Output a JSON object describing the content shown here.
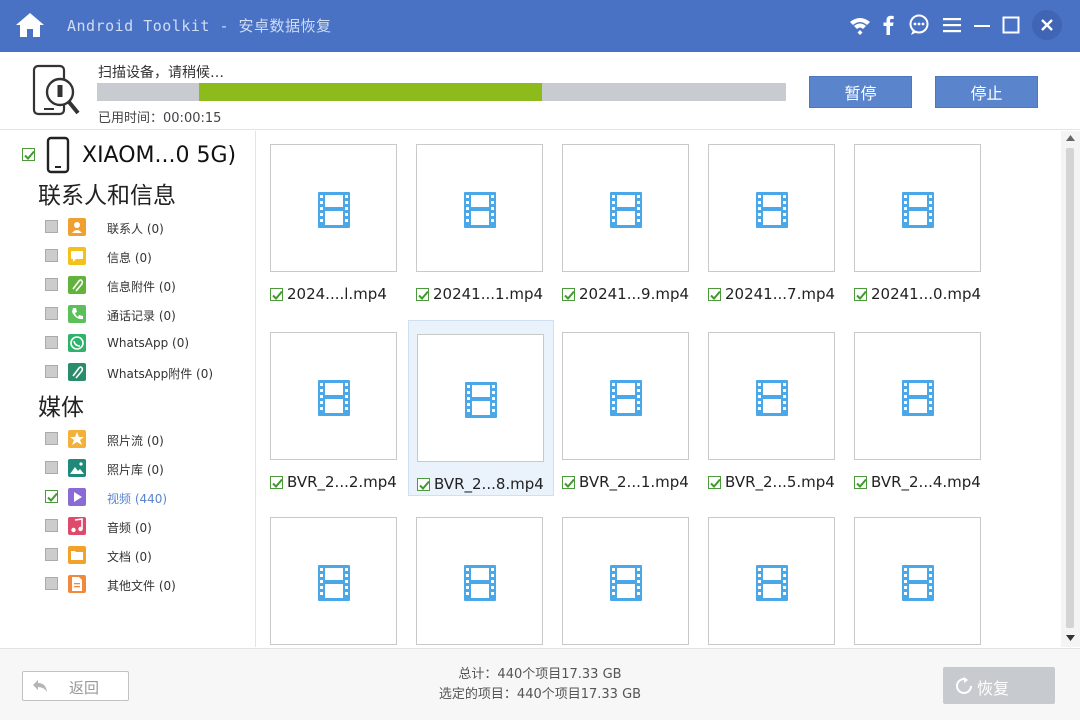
{
  "app": {
    "title": "Android Toolkit - 安卓数据恢复"
  },
  "scan": {
    "status": "扫描设备，请稍候…",
    "elapsed_label": "已用时间：",
    "elapsed_value": "00:00:15",
    "progress": 0.5,
    "pause_label": "暂停",
    "stop_label": "停止"
  },
  "sidebar": {
    "device_name": "XIAOM...0 5G)",
    "groups": [
      {
        "title": "联系人和信息",
        "items": [
          {
            "label": "联系人 (0)",
            "icon": "contacts-icon",
            "color": "#f0a030"
          },
          {
            "label": "信息 (0)",
            "icon": "messages-icon",
            "color": "#f2c21b"
          },
          {
            "label": "信息附件 (0)",
            "icon": "message-attachment-icon",
            "color": "#62b33b"
          },
          {
            "label": "通话记录 (0)",
            "icon": "call-log-icon",
            "color": "#5cc05a"
          },
          {
            "label": "WhatsApp (0)",
            "icon": "whatsapp-icon",
            "color": "#2fb36a"
          },
          {
            "label": "WhatsApp附件 (0)",
            "icon": "whatsapp-attachment-icon",
            "color": "#2a8c6a"
          }
        ]
      },
      {
        "title": "媒体",
        "items": [
          {
            "label": "照片流 (0)",
            "icon": "photo-stream-icon",
            "color": "#f4b13a"
          },
          {
            "label": "照片库 (0)",
            "icon": "photo-library-icon",
            "color": "#1f8a7a"
          },
          {
            "label": "视频 (440)",
            "icon": "video-icon",
            "color": "#8a6bd6",
            "checked": true
          },
          {
            "label": "音频 (0)",
            "icon": "audio-icon",
            "color": "#e04a6a"
          },
          {
            "label": "文档 (0)",
            "icon": "document-icon",
            "color": "#f2a22b"
          },
          {
            "label": "其他文件 (0)",
            "icon": "other-files-icon",
            "color": "#f08a3a"
          }
        ]
      }
    ]
  },
  "files": [
    {
      "name": "2024....l.mp4",
      "checked": true
    },
    {
      "name": "20241...1.mp4",
      "checked": true
    },
    {
      "name": "20241...9.mp4",
      "checked": true
    },
    {
      "name": "20241...7.mp4",
      "checked": true
    },
    {
      "name": "20241...0.mp4",
      "checked": true
    },
    {
      "name": "BVR_2...2.mp4",
      "checked": true
    },
    {
      "name": "BVR_2...8.mp4",
      "checked": true,
      "highlighted": true
    },
    {
      "name": "BVR_2...1.mp4",
      "checked": true
    },
    {
      "name": "BVR_2...5.mp4",
      "checked": true
    },
    {
      "name": "BVR_2...4.mp4",
      "checked": true
    },
    {
      "name": "",
      "checked": true
    },
    {
      "name": "",
      "checked": true
    },
    {
      "name": "",
      "checked": true
    },
    {
      "name": "",
      "checked": true
    },
    {
      "name": "",
      "checked": true
    }
  ],
  "footer": {
    "back_label": "返回",
    "total_line": "总计：440个项目17.33 GB",
    "selected_line": "选定的项目：440个项目17.33 GB",
    "recover_label": "恢复"
  },
  "colors": {
    "titlebar": "#4a72c4",
    "accent_button": "#5a84cc",
    "progress_fill": "#8dbb1c",
    "video_icon": "#4aa8e8"
  }
}
